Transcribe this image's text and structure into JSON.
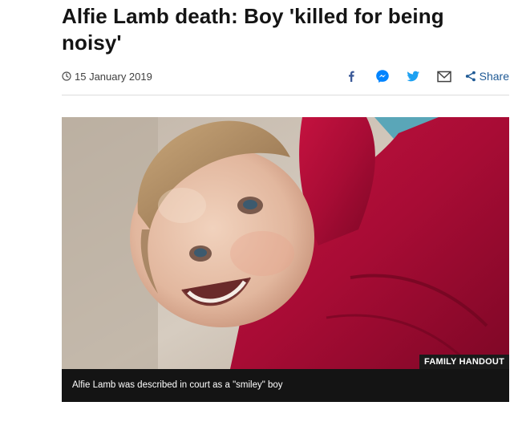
{
  "article": {
    "headline": "Alfie Lamb death: Boy 'killed for being noisy'",
    "date": "15 January 2019"
  },
  "share": {
    "label": "Share",
    "icons": [
      "facebook-icon",
      "messenger-icon",
      "twitter-icon",
      "email-icon",
      "share-icon"
    ]
  },
  "image": {
    "copyright": "FAMILY HANDOUT",
    "caption": "Alfie Lamb was described in court as a \"smiley\" boy"
  },
  "colors": {
    "headline": "#141414",
    "meta": "#404040",
    "share_link": "#1f5a95",
    "facebook": "#3b5998",
    "messenger": "#0084ff",
    "twitter": "#1da1f2",
    "caption_bg": "#141414"
  }
}
